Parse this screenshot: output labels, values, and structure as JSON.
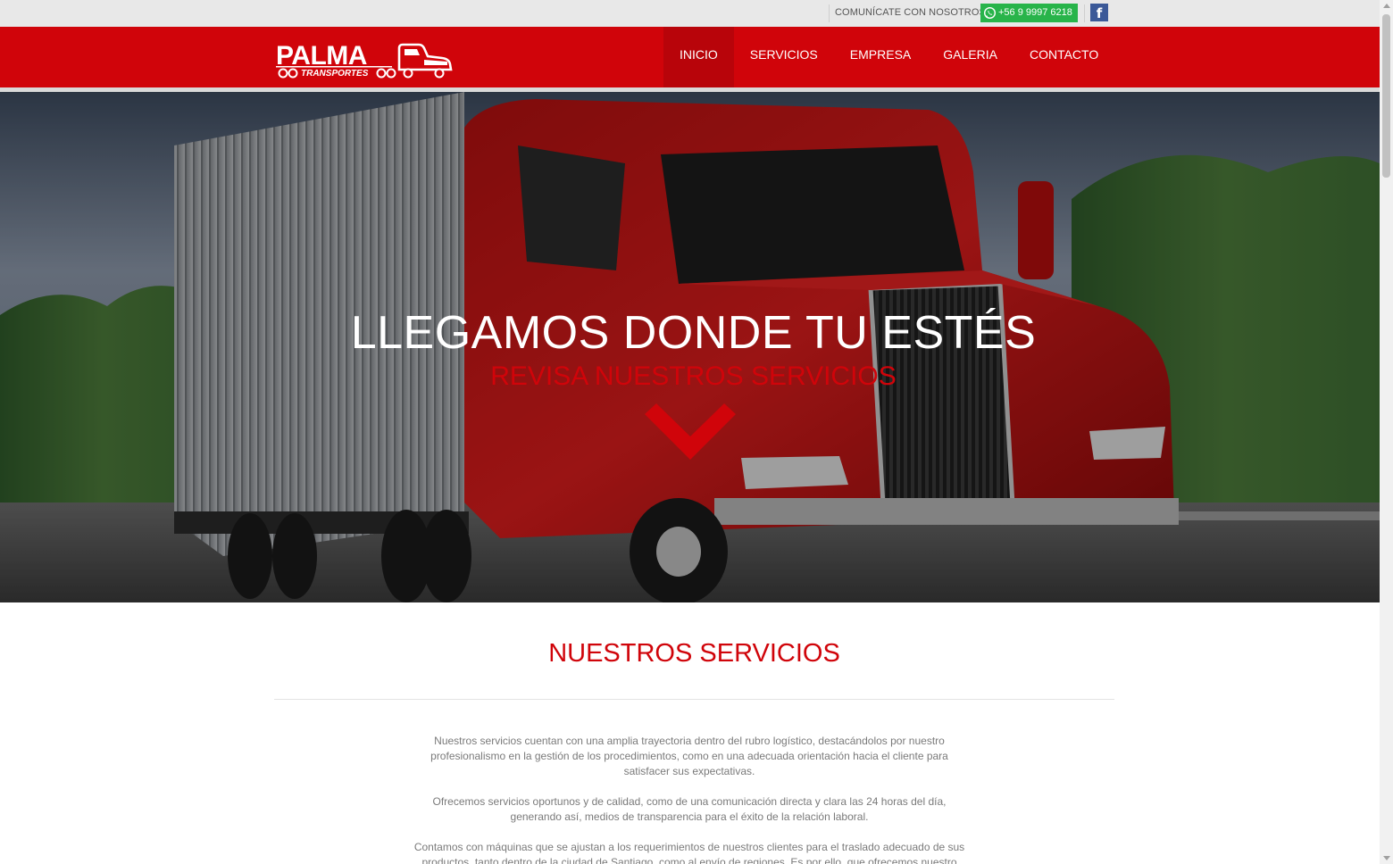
{
  "topbar": {
    "contact_label": "COMUNÍCATE CON NOSOTROS",
    "phone": "+56 9  9997 6218",
    "facebook_glyph": "f",
    "colors": {
      "whatsapp": "#28b44a",
      "facebook": "#3b5998"
    }
  },
  "header": {
    "logo_main": "PALMA",
    "logo_sub": "TRANSPORTES",
    "nav": [
      {
        "label": "INICIO",
        "active": true
      },
      {
        "label": "SERVICIOS",
        "active": false
      },
      {
        "label": "EMPRESA",
        "active": false
      },
      {
        "label": "GALERIA",
        "active": false
      },
      {
        "label": "CONTACTO",
        "active": false
      }
    ],
    "brand_color": "#d0040a"
  },
  "hero": {
    "title": "LLEGAMOS DONDE TU ESTÉS",
    "subtitle": "REVISA NUESTROS SERVICIOS",
    "chevron_icon": "chevron-down-icon"
  },
  "services": {
    "title": "NUESTROS SERVICIOS",
    "paragraphs": [
      "Nuestros servicios cuentan con una amplia trayectoria dentro del rubro logístico, destacándolos por nuestro profesionalismo en la gestión de los procedimientos, como en una adecuada orientación hacia el cliente para satisfacer sus expectativas.",
      "Ofrecemos servicios oportunos y de calidad, como de una comunicación directa y clara las 24  horas del día, generando así, medios de transparencia para el éxito de la relación laboral.",
      "Contamos con máquinas que se ajustan a los requerimientos de nuestros clientes para el traslado adecuado de sus productos, tanto dentro de la ciudad de Santiago, como al envío de regiones. Es por ello, que ofrecemos nuestro"
    ]
  }
}
